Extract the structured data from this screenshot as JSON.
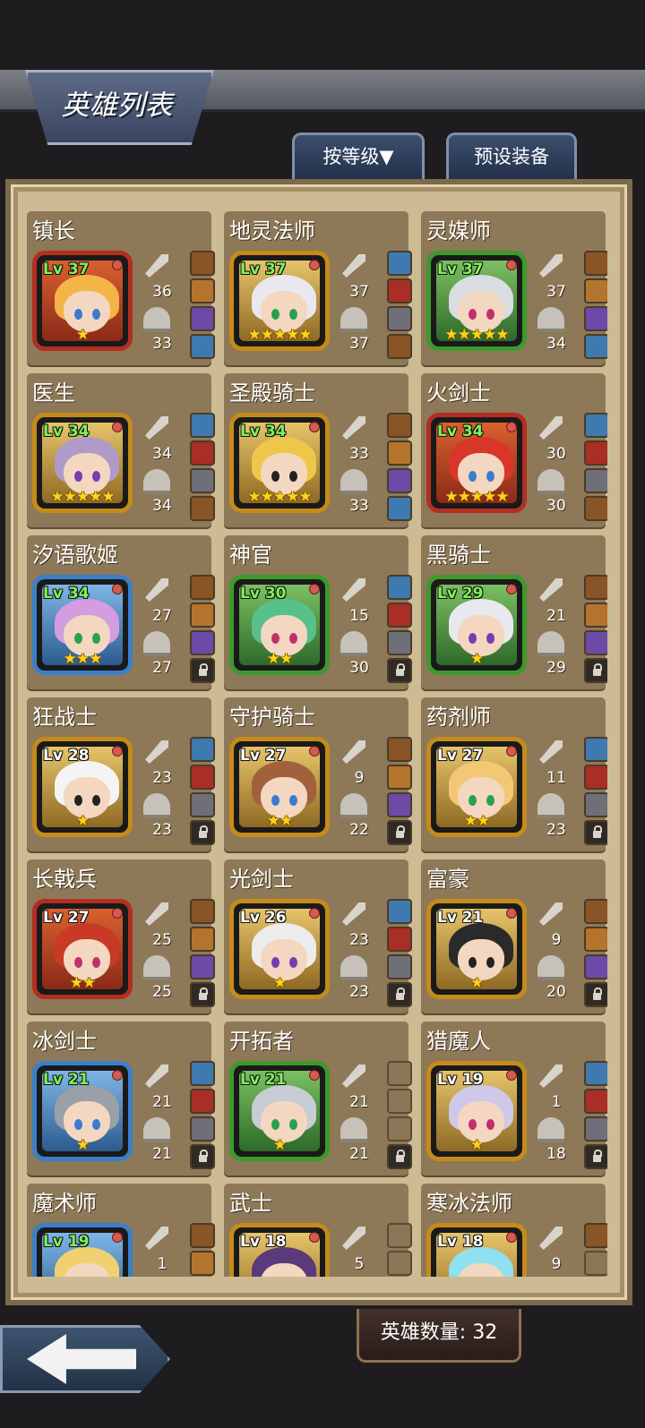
{
  "header": {
    "title": "英雄列表",
    "sort_label": "按等级▼",
    "preset_label": "预设装备"
  },
  "footer": {
    "hero_count": "英雄数量: 32",
    "back_icon": "left-arrow-icon"
  },
  "colors": {
    "frame_red": "#b42e20",
    "frame_green": "#3c9a2c",
    "frame_gold": "#c58b1a",
    "frame_blue": "#3a80c8",
    "level_green": "#7ff05a",
    "level_white": "#ffffff",
    "star": "#ffd21c"
  },
  "heroes": [
    {
      "name": "镇长",
      "level": "Lv 37",
      "attack": "36",
      "defense": "33",
      "stars": "★",
      "frame": "red",
      "slots": [
        "equipped",
        "equipped",
        "equipped",
        "equipped"
      ]
    },
    {
      "name": "地灵法师",
      "level": "Lv 37",
      "attack": "37",
      "defense": "37",
      "stars": "★★★★★",
      "frame": "gold",
      "slots": [
        "equipped",
        "equipped",
        "equipped",
        "equipped"
      ]
    },
    {
      "name": "灵媒师",
      "level": "Lv 37",
      "attack": "37",
      "defense": "34",
      "stars": "★★★★★",
      "frame": "green",
      "slots": [
        "equipped",
        "equipped",
        "equipped",
        "equipped"
      ]
    },
    {
      "name": "医生",
      "level": "Lv 34",
      "attack": "34",
      "defense": "34",
      "stars": "★★★★★",
      "frame": "gold",
      "slots": [
        "equipped",
        "equipped",
        "equipped",
        "equipped"
      ]
    },
    {
      "name": "圣殿骑士",
      "level": "Lv 34",
      "attack": "33",
      "defense": "33",
      "stars": "★★★★★",
      "frame": "gold",
      "slots": [
        "equipped",
        "equipped",
        "equipped",
        "equipped"
      ]
    },
    {
      "name": "火剑士",
      "level": "Lv 34",
      "attack": "30",
      "defense": "30",
      "stars": "★★★★★",
      "frame": "red",
      "slots": [
        "equipped",
        "equipped",
        "equipped",
        "equipped"
      ]
    },
    {
      "name": "汐语歌姬",
      "level": "Lv 34",
      "attack": "27",
      "defense": "27",
      "stars": "★★★",
      "frame": "blue",
      "slots": [
        "equipped",
        "equipped",
        "equipped",
        "locked"
      ]
    },
    {
      "name": "神官",
      "level": "Lv 30",
      "attack": "15",
      "defense": "30",
      "stars": "★★",
      "frame": "green",
      "slots": [
        "equipped",
        "equipped",
        "equipped",
        "locked"
      ]
    },
    {
      "name": "黑骑士",
      "level": "Lv 29",
      "attack": "21",
      "defense": "29",
      "stars": "★",
      "frame": "green",
      "slots": [
        "equipped",
        "equipped",
        "equipped",
        "locked"
      ]
    },
    {
      "name": "狂战士",
      "level": "Lv 28",
      "attack": "23",
      "defense": "23",
      "stars": "★",
      "frame": "gold",
      "slots": [
        "equipped",
        "equipped",
        "equipped",
        "locked"
      ]
    },
    {
      "name": "守护骑士",
      "level": "Lv 27",
      "attack": "9",
      "defense": "22",
      "stars": "★★",
      "frame": "gold",
      "slots": [
        "equipped",
        "equipped",
        "equipped",
        "locked"
      ]
    },
    {
      "name": "药剂师",
      "level": "Lv 27",
      "attack": "11",
      "defense": "23",
      "stars": "★★",
      "frame": "gold",
      "slots": [
        "equipped",
        "equipped",
        "equipped",
        "locked"
      ]
    },
    {
      "name": "长戟兵",
      "level": "Lv 27",
      "attack": "25",
      "defense": "25",
      "stars": "★★",
      "frame": "red",
      "slots": [
        "equipped",
        "equipped",
        "equipped",
        "locked"
      ]
    },
    {
      "name": "光剑士",
      "level": "Lv 26",
      "attack": "23",
      "defense": "23",
      "stars": "★",
      "frame": "gold",
      "slots": [
        "equipped",
        "equipped",
        "equipped",
        "locked"
      ]
    },
    {
      "name": "富豪",
      "level": "Lv 21",
      "attack": "9",
      "defense": "20",
      "stars": "★",
      "frame": "gold",
      "slots": [
        "equipped",
        "equipped",
        "equipped",
        "locked"
      ]
    },
    {
      "name": "冰剑士",
      "level": "Lv 21",
      "attack": "21",
      "defense": "21",
      "stars": "★",
      "frame": "blue",
      "slots": [
        "equipped",
        "equipped",
        "equipped",
        "locked"
      ]
    },
    {
      "name": "开拓者",
      "level": "Lv 21",
      "attack": "21",
      "defense": "21",
      "stars": "★",
      "frame": "green",
      "slots": [
        "empty",
        "empty",
        "empty",
        "locked"
      ]
    },
    {
      "name": "猎魔人",
      "level": "Lv 19",
      "attack": "1",
      "defense": "18",
      "stars": "★",
      "frame": "gold",
      "slots": [
        "equipped",
        "equipped",
        "equipped",
        "locked"
      ]
    },
    {
      "name": "魔术师",
      "level": "Lv 19",
      "attack": "1",
      "defense": "",
      "stars": "",
      "frame": "blue",
      "slots": [
        "equipped",
        "equipped",
        "equipped",
        "locked"
      ]
    },
    {
      "name": "武士",
      "level": "Lv 18",
      "attack": "5",
      "defense": "",
      "stars": "",
      "frame": "gold",
      "slots": [
        "empty",
        "empty",
        "empty",
        "locked"
      ]
    },
    {
      "name": "寒冰法师",
      "level": "Lv 18",
      "attack": "9",
      "defense": "",
      "stars": "",
      "frame": "gold",
      "slots": [
        "equipped",
        "empty",
        "empty",
        "locked"
      ]
    }
  ]
}
